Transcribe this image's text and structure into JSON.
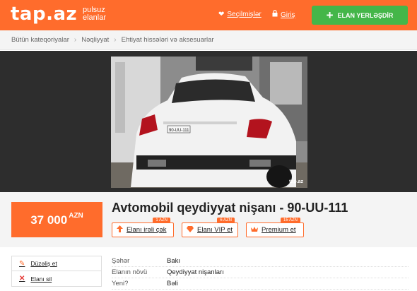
{
  "header": {
    "logo": "tap.az",
    "logo_sub_1": "pulsuz",
    "logo_sub_2": "elanlar",
    "favorites": "Seçilmişlər",
    "login": "Giriş",
    "post_button": "ELAN YERLƏŞDİR",
    "colors": {
      "brand": "#ff6c2c",
      "post": "#44b649"
    }
  },
  "breadcrumb": [
    "Bütün kateqoriyalar",
    "Nəqliyyat",
    "Ehtiyat hissələri və aksesuarlar"
  ],
  "gallery": {
    "watermark": "tap.az",
    "plate": "90-UU-111"
  },
  "listing": {
    "price": "37 000",
    "currency": "AZN",
    "title": "Avtomobil qeydiyyat nişanı - 90-UU-111"
  },
  "promotions": [
    {
      "label": "Elanı irəli çək",
      "price": "1 AZN",
      "icon": "arrow-up-icon"
    },
    {
      "label": "Elanı VIP et",
      "price": "6 AZN",
      "icon": "diamond-icon"
    },
    {
      "label": "Premium et",
      "price": "15 AZN",
      "icon": "crown-icon"
    }
  ],
  "actions": {
    "edit": "Düzəliş et",
    "delete": "Elanı sil"
  },
  "properties": [
    {
      "key": "Şəhər",
      "value": "Bakı"
    },
    {
      "key": "Elanın növü",
      "value": "Qeydiyyat nişanları"
    },
    {
      "key": "Yeni?",
      "value": "Bəli"
    }
  ]
}
